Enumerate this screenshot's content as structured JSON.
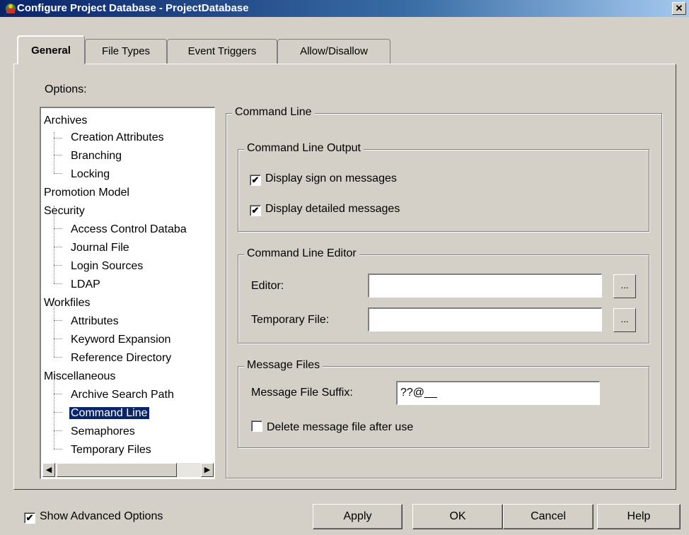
{
  "window": {
    "title": "Configure Project Database - ProjectDatabase",
    "close_glyph": "✕"
  },
  "tabs": [
    {
      "label": "General",
      "active": true
    },
    {
      "label": "File Types",
      "active": false
    },
    {
      "label": "Event Triggers",
      "active": false
    },
    {
      "label": "Allow/Disallow",
      "active": false
    }
  ],
  "options_label": "Options:",
  "tree": [
    {
      "label": "Archives",
      "level": 0
    },
    {
      "label": "Creation Attributes",
      "level": 1
    },
    {
      "label": "Branching",
      "level": 1
    },
    {
      "label": "Locking",
      "level": 1
    },
    {
      "label": "Promotion Model",
      "level": 0
    },
    {
      "label": "Security",
      "level": 0
    },
    {
      "label": "Access Control Databa",
      "level": 1
    },
    {
      "label": "Journal File",
      "level": 1
    },
    {
      "label": "Login Sources",
      "level": 1
    },
    {
      "label": "LDAP",
      "level": 1
    },
    {
      "label": "Workfiles",
      "level": 0
    },
    {
      "label": "Attributes",
      "level": 1
    },
    {
      "label": "Keyword Expansion",
      "level": 1
    },
    {
      "label": "Reference Directory",
      "level": 1
    },
    {
      "label": "Miscellaneous",
      "level": 0
    },
    {
      "label": "Archive Search Path",
      "level": 1
    },
    {
      "label": "Command Line",
      "level": 1,
      "selected": true
    },
    {
      "label": "Semaphores",
      "level": 1
    },
    {
      "label": "Temporary Files",
      "level": 1
    }
  ],
  "command_line": {
    "title": "Command Line",
    "output": {
      "title": "Command Line Output",
      "display_sign_on": {
        "label": "Display sign on messages",
        "checked": true
      },
      "display_detailed": {
        "label": "Display detailed messages",
        "checked": true
      }
    },
    "editor": {
      "title": "Command Line Editor",
      "editor_label": "Editor:",
      "editor_value": "",
      "temp_label": "Temporary File:",
      "temp_value": "",
      "browse_label": "..."
    },
    "message_files": {
      "title": "Message Files",
      "suffix_label": "Message File Suffix:",
      "suffix_value": "??@__",
      "delete": {
        "label": "Delete message file after use",
        "checked": false
      }
    }
  },
  "footer": {
    "show_advanced": {
      "label": "Show Advanced Options",
      "checked": true
    },
    "apply": "Apply",
    "ok": "OK",
    "cancel": "Cancel",
    "help": "Help"
  }
}
